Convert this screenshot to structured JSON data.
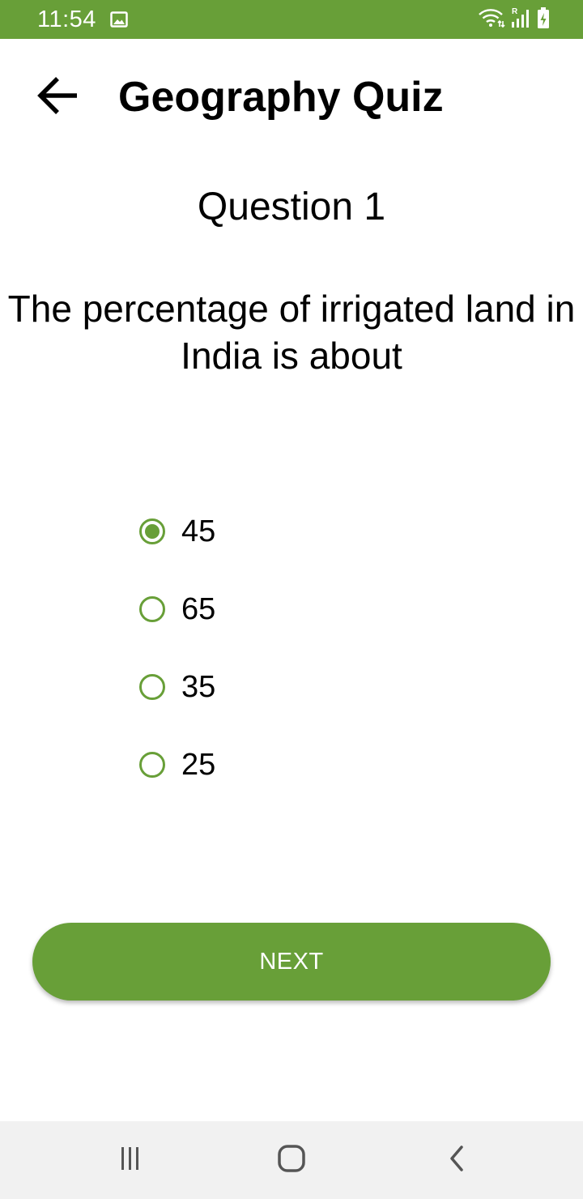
{
  "status_bar": {
    "time": "11:54",
    "icons": [
      "gallery-icon",
      "wifi-icon",
      "signal-icon",
      "battery-charging-icon"
    ],
    "background": "#689f38"
  },
  "app_bar": {
    "title": "Geography Quiz",
    "back_icon": "arrow-back-icon"
  },
  "quiz": {
    "question_label": "Question 1",
    "question_text": "The percentage of irrigated land in India is about",
    "options": [
      {
        "label": "45",
        "selected": true
      },
      {
        "label": "65",
        "selected": false
      },
      {
        "label": "35",
        "selected": false
      },
      {
        "label": "25",
        "selected": false
      }
    ],
    "next_label": "NEXT"
  },
  "navigation_bar": {
    "buttons": [
      "recent-apps-icon",
      "home-icon",
      "back-icon"
    ]
  },
  "colors": {
    "accent": "#689f38",
    "nav_bar": "#f1f1f1",
    "text": "#000000"
  }
}
